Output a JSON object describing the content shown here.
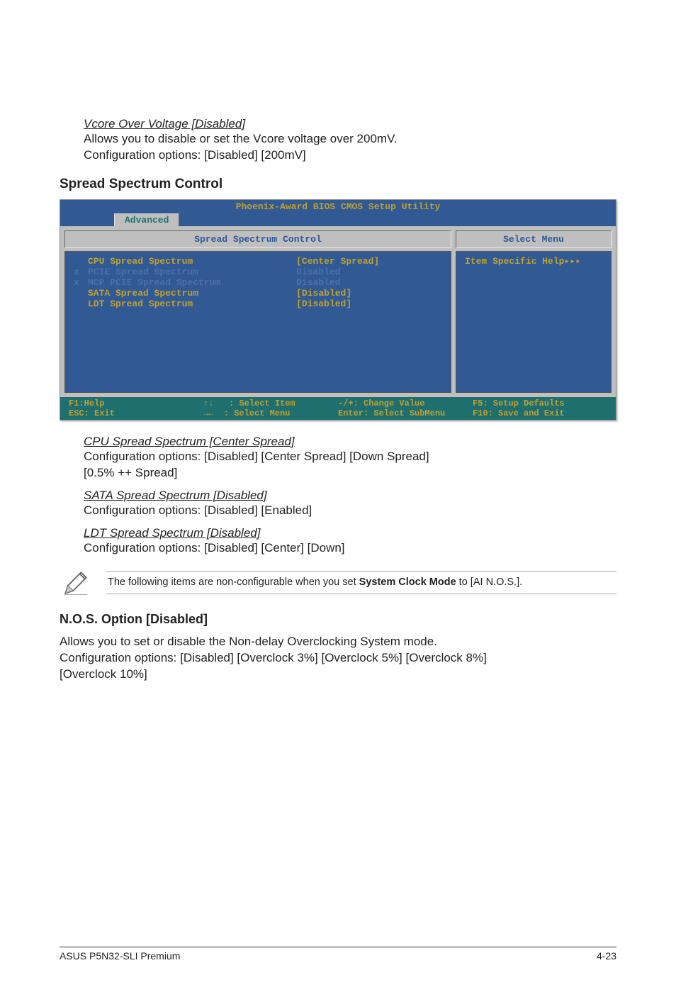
{
  "sec1": {
    "title": "Vcore Over Voltage [Disabled]",
    "line1": "Allows you to disable or set the Vcore voltage over 200mV.",
    "line2": "Configuration options: [Disabled] [200mV]"
  },
  "heading_spread": "Spread Spectrum Control",
  "bios": {
    "title": "Phoenix-Award BIOS CMOS Setup Utility",
    "tab": "Advanced",
    "header_left": "Spread Spectrum Control",
    "header_right": "Select Menu",
    "rows": [
      {
        "pref": "",
        "label": "CPU Spread Spectrum",
        "value": "[Center Spread]",
        "dim": false
      },
      {
        "pref": "x",
        "label": "PCIE Spread Spectrum",
        "value": "Disabled",
        "dim": true
      },
      {
        "pref": "x",
        "label": "MCP PCIE Spread Spectrum",
        "value": "Disabled",
        "dim": true
      },
      {
        "pref": "",
        "label": "SATA Spread Spectrum",
        "value": "[Disabled]",
        "dim": false
      },
      {
        "pref": "",
        "label": "LDT Spread Spectrum",
        "value": "[Disabled]",
        "dim": false
      }
    ],
    "right_body": "Item Specific Help▸▸▸",
    "footer": {
      "c1a": "F1:Help",
      "c1b": "ESC: Exit",
      "c2a": "↑↓   : Select Item",
      "c2b": "→←  : Select Menu",
      "c3a": "-/+: Change Value",
      "c3b": "Enter: Select SubMenu",
      "c4a": "F5: Setup Defaults",
      "c4b": "F10: Save and Exit"
    }
  },
  "sub_cpu": {
    "title": "CPU Spread Spectrum [Center Spread]",
    "line1": "Configuration options: [Disabled] [Center Spread] [Down Spread]",
    "line2": "[0.5% ++ Spread]"
  },
  "sub_sata": {
    "title": "SATA Spread Spectrum [Disabled]",
    "line1": "Configuration options: [Disabled] [Enabled]"
  },
  "sub_ldt": {
    "title": "LDT Spread Spectrum [Disabled]",
    "line1_a": "Configuration options: [Disabled] [Center] ",
    "line1_b": "[Down]"
  },
  "note": {
    "text_a": "The following items are non-configurable when you set ",
    "text_bold": "System Clock Mode",
    "text_b": " to [AI N.O.S.]."
  },
  "nos": {
    "heading": "N.O.S. Option [Disabled]",
    "line1": "Allows you to set or disable the Non-delay Overclocking System mode.",
    "line2_a": "Configuration options: [Disabled] [Overclock 3%] ",
    "line2_b": "[Overclock 5%] [Overclock 8%]",
    "line3": "[Overclock 10%]"
  },
  "footer": {
    "left": "ASUS P5N32-SLI Premium",
    "right": "4-23"
  }
}
